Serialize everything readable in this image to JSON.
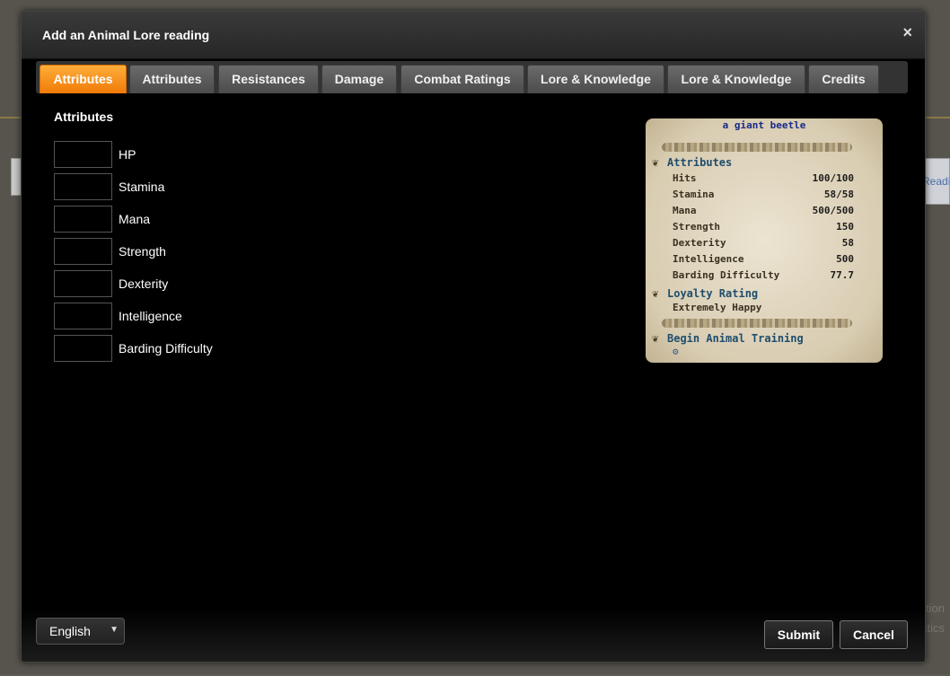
{
  "background": {
    "side_text_right": "Reading",
    "corner_text_1": "ation",
    "corner_text_2": "atics"
  },
  "modal": {
    "title": "Add an Animal Lore reading",
    "close_symbol": "×"
  },
  "tabs": [
    {
      "label": "Attributes",
      "active": true
    },
    {
      "label": "Attributes",
      "active": false
    },
    {
      "label": "Resistances",
      "active": false
    },
    {
      "label": "Damage",
      "active": false
    },
    {
      "label": "Combat Ratings",
      "active": false
    },
    {
      "label": "Lore & Knowledge",
      "active": false
    },
    {
      "label": "Lore & Knowledge",
      "active": false
    },
    {
      "label": "Credits",
      "active": false
    }
  ],
  "form": {
    "heading": "Attributes",
    "fields": [
      {
        "label": "HP",
        "value": ""
      },
      {
        "label": "Stamina",
        "value": ""
      },
      {
        "label": "Mana",
        "value": ""
      },
      {
        "label": "Strength",
        "value": ""
      },
      {
        "label": "Dexterity",
        "value": ""
      },
      {
        "label": "Intelligence",
        "value": ""
      },
      {
        "label": "Barding Difficulty",
        "value": ""
      }
    ]
  },
  "lore_card": {
    "creature": "a giant beetle",
    "section_attributes": "Attributes",
    "rows": [
      {
        "label": "Hits",
        "value": "100/100"
      },
      {
        "label": "Stamina",
        "value": "58/58"
      },
      {
        "label": "Mana",
        "value": "500/500"
      },
      {
        "label": "Strength",
        "value": "150"
      },
      {
        "label": "Dexterity",
        "value": "58"
      },
      {
        "label": "Intelligence",
        "value": "500"
      },
      {
        "label": "Barding Difficulty",
        "value": "77.7"
      }
    ],
    "section_loyalty": "Loyalty Rating",
    "loyalty_value": "Extremely Happy",
    "section_training": "Begin Animal Training",
    "arrow_symbol": "❦",
    "gear_symbol": "⚙"
  },
  "footer": {
    "language": "English",
    "submit_label": "Submit",
    "cancel_label": "Cancel"
  },
  "colors": {
    "active_tab": "#f7941d",
    "creature_name": "#1a2b8a",
    "section_heading": "#1f4d6d"
  }
}
